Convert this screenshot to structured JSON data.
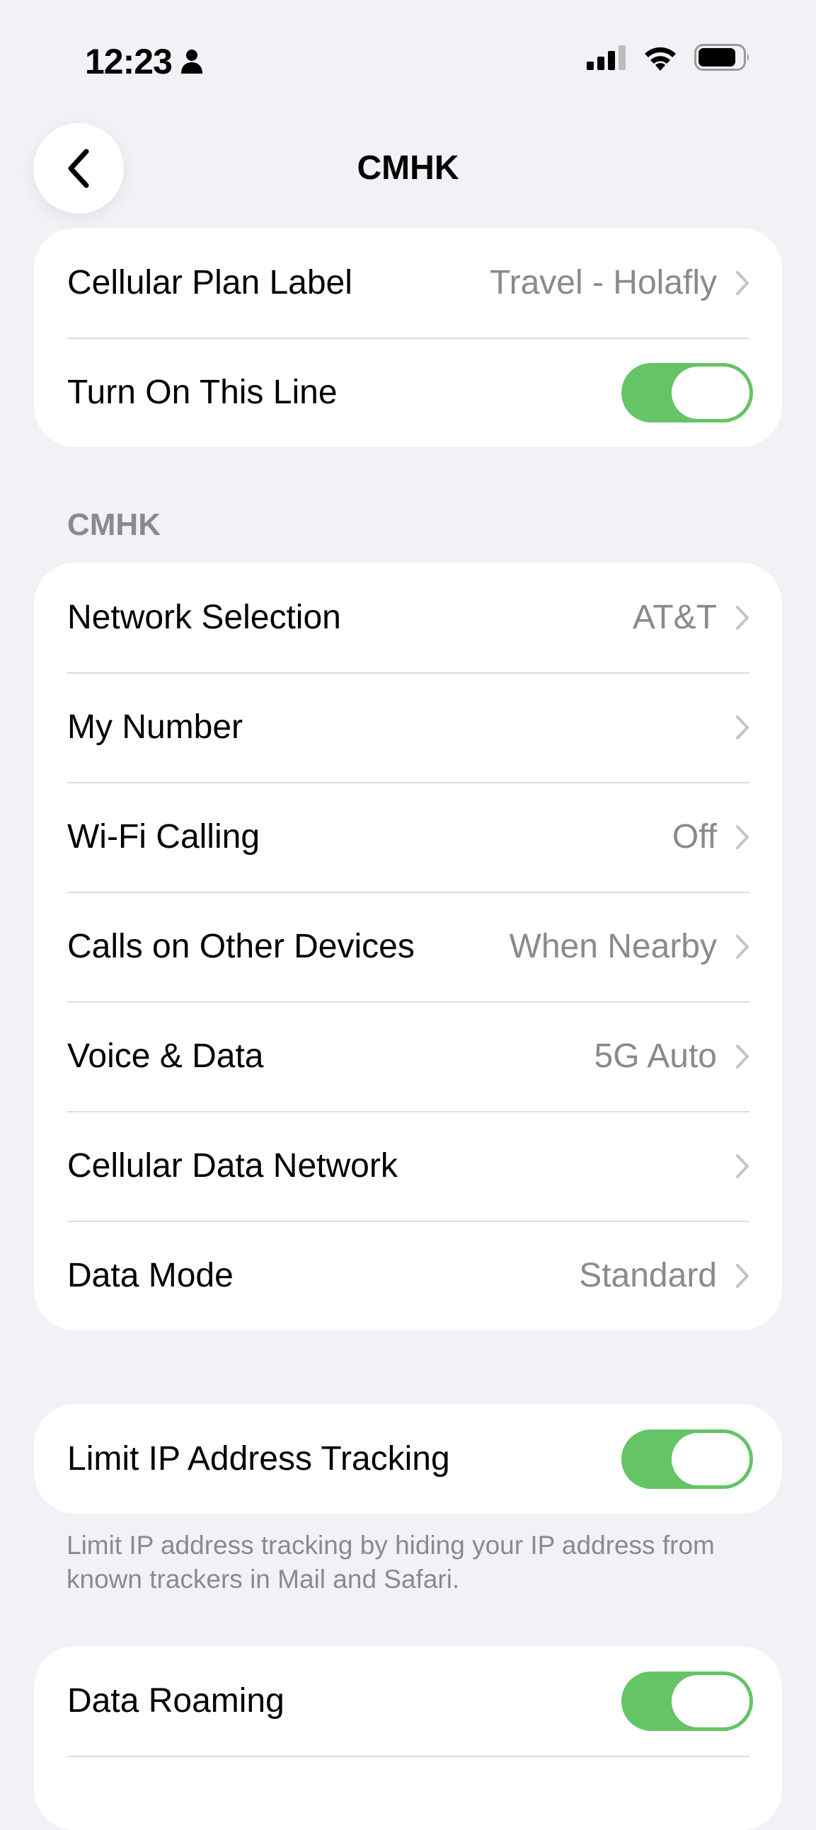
{
  "status_bar": {
    "time": "12:23"
  },
  "nav": {
    "title": "CMHK",
    "back_icon": "chevron-left-icon"
  },
  "group_plan": {
    "rows": [
      {
        "label": "Cellular Plan Label",
        "value": "Travel - Holafly",
        "control": "chevron"
      },
      {
        "label": "Turn On This Line",
        "control": "toggle",
        "on": true
      }
    ]
  },
  "section": {
    "header": "CMHK",
    "rows": [
      {
        "label": "Network Selection",
        "value": "AT&T"
      },
      {
        "label": "My Number",
        "value": ""
      },
      {
        "label": "Wi-Fi Calling",
        "value": "Off"
      },
      {
        "label": "Calls on Other Devices",
        "value": "When Nearby"
      },
      {
        "label": "Voice & Data",
        "value": "5G Auto"
      },
      {
        "label": "Cellular Data Network",
        "value": ""
      },
      {
        "label": "Data Mode",
        "value": "Standard"
      }
    ]
  },
  "limit_ip": {
    "label": "Limit IP Address Tracking",
    "on": true,
    "footer": "Limit IP address tracking by hiding your IP address from known trackers in Mail and Safari."
  },
  "roaming": {
    "label": "Data Roaming",
    "on": true
  },
  "colors": {
    "background": "#f1f1f6",
    "toggle_on": "#65c466",
    "secondary_text": "#8a8a8e"
  }
}
